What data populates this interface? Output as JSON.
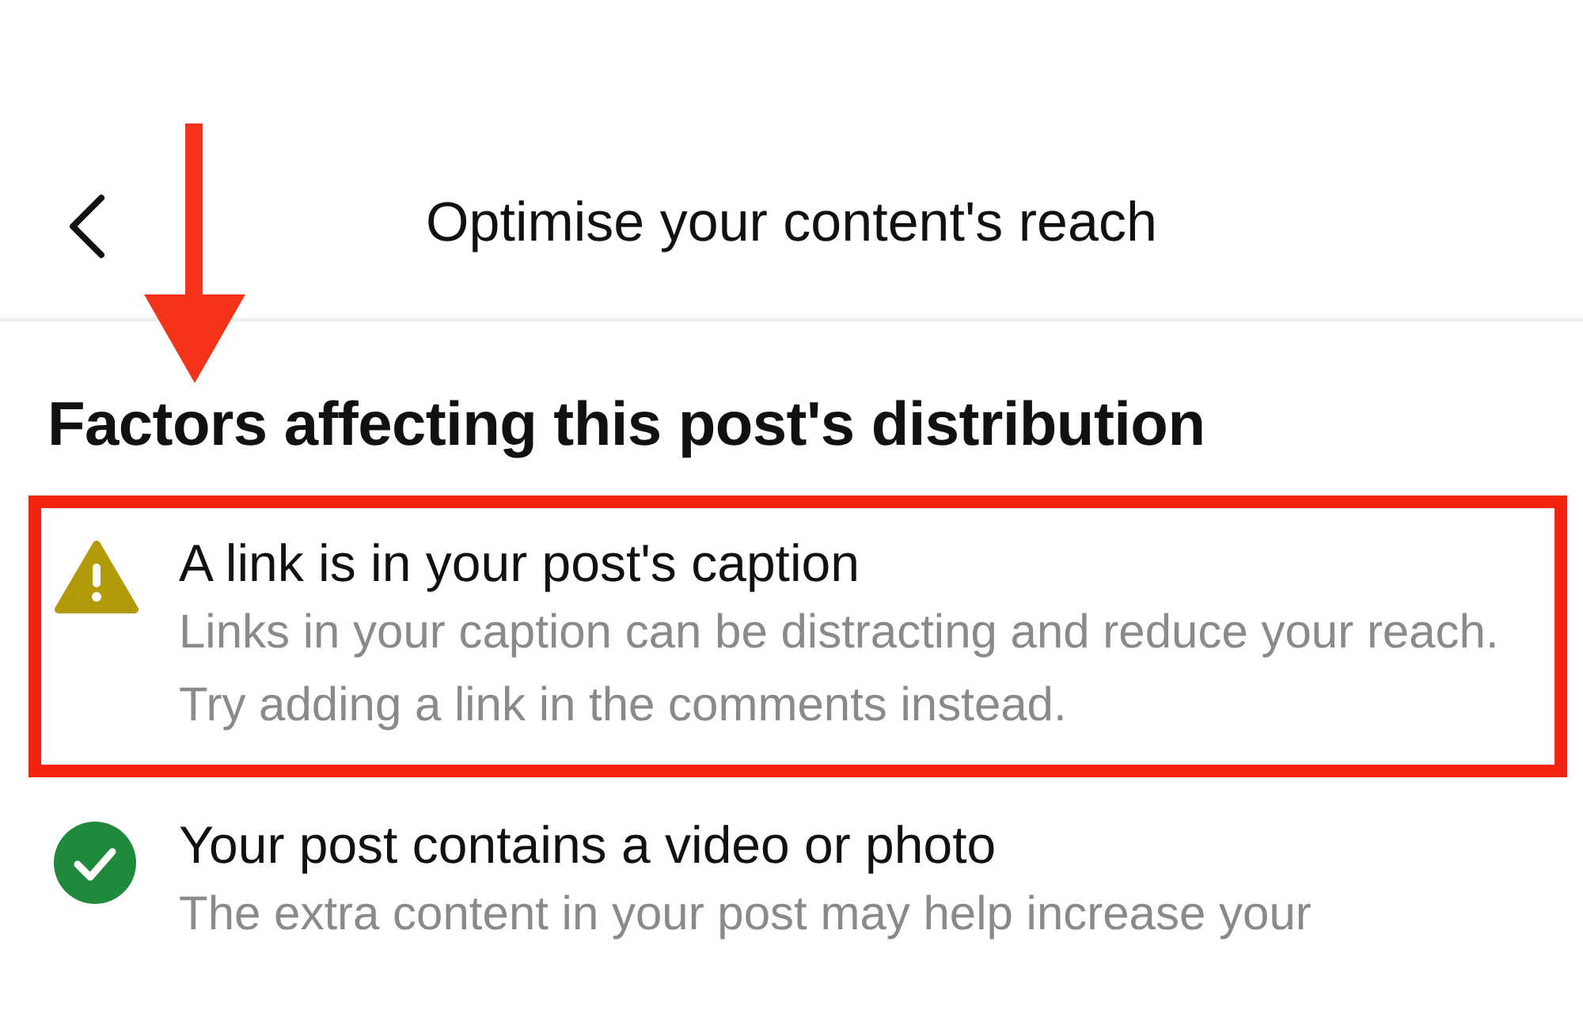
{
  "header": {
    "title": "Optimise your content's reach"
  },
  "pointer_arrow": true,
  "heading": "Factors affecting this post's distribution",
  "items": [
    {
      "kind": "warning",
      "highlighted": true,
      "title": "A link is in your post's caption",
      "description": "Links in your caption can be distracting and reduce your reach. Try adding a link in the comments instead."
    },
    {
      "kind": "ok",
      "highlighted": false,
      "title": "Your post contains a video or photo",
      "description": "The extra content in your post may help increase your"
    }
  ]
}
